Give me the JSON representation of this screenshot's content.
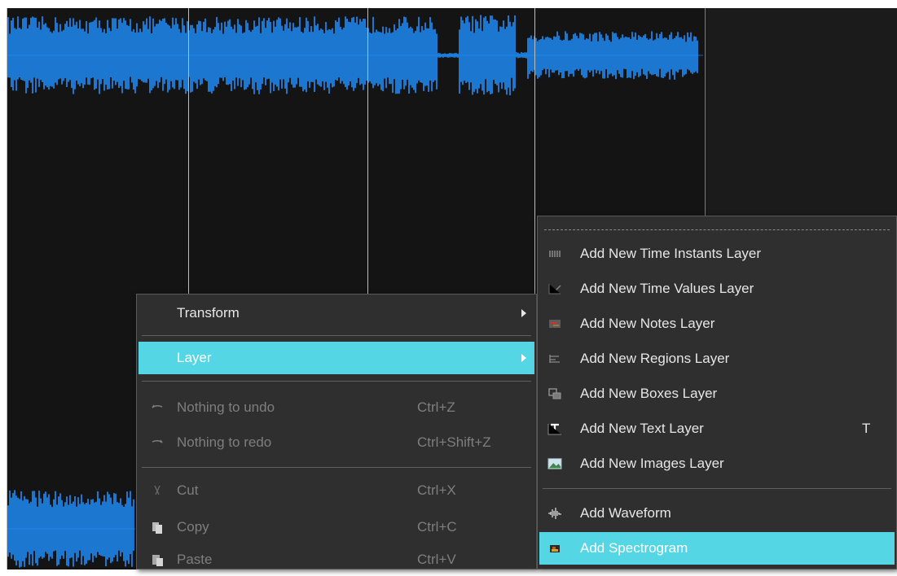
{
  "context_menu": {
    "items": [
      {
        "label": "Transform",
        "has_submenu": true
      },
      {
        "label": "Layer",
        "has_submenu": true,
        "highlighted": true
      },
      {
        "label": "Nothing to undo",
        "shortcut": "Ctrl+Z",
        "disabled": true,
        "icon": "undo-icon"
      },
      {
        "label": "Nothing to redo",
        "shortcut": "Ctrl+Shift+Z",
        "disabled": true,
        "icon": "redo-icon"
      },
      {
        "label": "Cut",
        "shortcut": "Ctrl+X",
        "disabled": true,
        "icon": "cut-icon"
      },
      {
        "label": "Copy",
        "shortcut": "Ctrl+C",
        "disabled": true,
        "icon": "copy-icon"
      },
      {
        "label": "Paste",
        "shortcut": "Ctrl+V",
        "disabled": true,
        "icon": "paste-icon"
      }
    ]
  },
  "layer_submenu": {
    "items": [
      {
        "label": "Add New Time Instants Layer",
        "icon": "time-instants-icon"
      },
      {
        "label": "Add New Time Values Layer",
        "icon": "time-values-icon"
      },
      {
        "label": "Add New Notes Layer",
        "icon": "notes-icon"
      },
      {
        "label": "Add New Regions Layer",
        "icon": "regions-icon"
      },
      {
        "label": "Add New Boxes Layer",
        "icon": "boxes-icon"
      },
      {
        "label": "Add New Text Layer",
        "shortcut": "T",
        "icon": "text-icon"
      },
      {
        "label": "Add New Images Layer",
        "icon": "images-icon"
      },
      {
        "label": "Add Waveform",
        "icon": "waveform-icon"
      },
      {
        "label": "Add Spectrogram",
        "icon": "spectrogram-icon",
        "highlighted": true
      }
    ]
  },
  "colors": {
    "highlight": "#54d6e4",
    "waveform": "#1e90ff",
    "menu_bg": "#2f2f2f",
    "pane_bg": "#141414"
  }
}
